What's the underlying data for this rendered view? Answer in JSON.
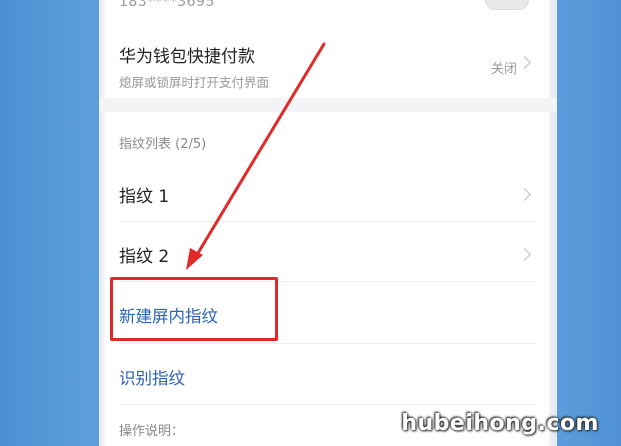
{
  "account": {
    "phone_masked": "183****3695"
  },
  "wallet_row": {
    "title": "华为钱包快捷付款",
    "subtitle": "熄屏或锁屏时打开支付界面",
    "value": "关闭"
  },
  "fingerprint_list": {
    "header": "指纹列表 (2/5)",
    "items": [
      {
        "label": "指纹 1"
      },
      {
        "label": "指纹 2"
      }
    ]
  },
  "actions": {
    "new_in_screen": "新建屏内指纹",
    "recognize": "识别指纹"
  },
  "notes": {
    "label": "操作说明："
  },
  "annotation": {
    "color": "#e02a2a"
  },
  "watermark": {
    "text": "hubeihong.com"
  },
  "colors": {
    "accent_blue": "#2a63b8",
    "background_blue": "#6aa8e0"
  }
}
